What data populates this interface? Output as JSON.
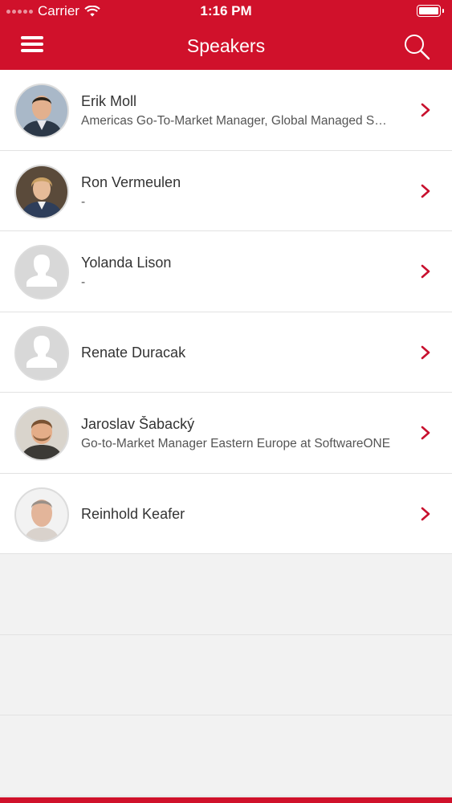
{
  "status_bar": {
    "carrier": "Carrier",
    "time": "1:16 PM"
  },
  "nav": {
    "title": "Speakers",
    "menu_icon": "hamburger-icon",
    "search_icon": "search-icon"
  },
  "colors": {
    "brand": "#d0112b",
    "background": "#f2f2f2"
  },
  "speakers": [
    {
      "name": "Erik Moll",
      "subtitle": "Americas Go-To-Market Manager, Global Managed S…",
      "avatar": "photo"
    },
    {
      "name": "Ron Vermeulen",
      "subtitle": "-",
      "avatar": "photo"
    },
    {
      "name": "Yolanda Lison",
      "subtitle": "-",
      "avatar": "placeholder"
    },
    {
      "name": "Renate Duracak",
      "subtitle": "",
      "avatar": "placeholder"
    },
    {
      "name": "Jaroslav Šabacký",
      "subtitle": "Go-to-Market Manager Eastern Europe at SoftwareONE",
      "avatar": "photo"
    },
    {
      "name": "Reinhold Keafer",
      "subtitle": "",
      "avatar": "photo"
    }
  ]
}
